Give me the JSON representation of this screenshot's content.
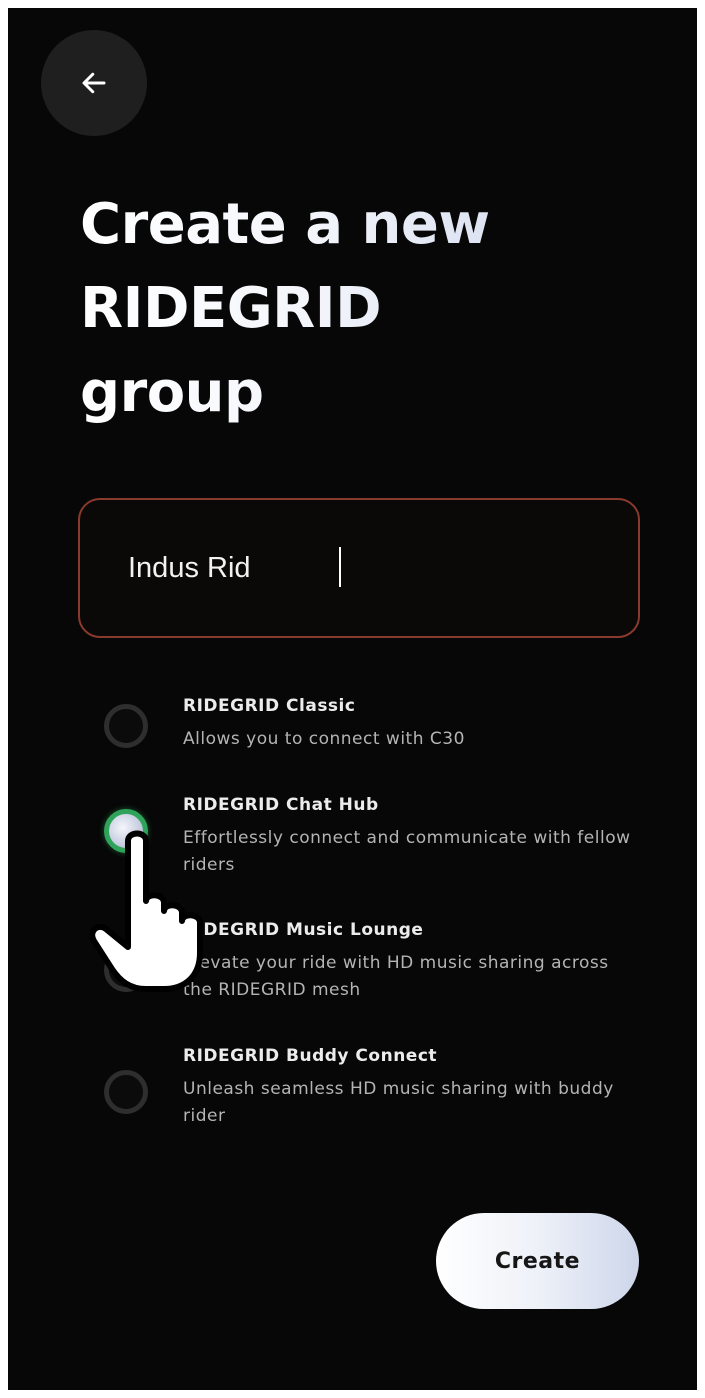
{
  "header": {
    "back_icon": "arrow-left-icon"
  },
  "title": {
    "line1": "Create a new",
    "line2": "RIDEGRID",
    "line3": "group"
  },
  "group_name": {
    "value": "Indus Rid"
  },
  "group_types": [
    {
      "title": "RIDEGRID Classic",
      "description": "Allows you to connect with C30",
      "selected": false
    },
    {
      "title": "RIDEGRID Chat Hub",
      "description": "Effortlessly connect and communicate with fellow riders",
      "selected": true
    },
    {
      "title": "RIDEGRID Music Lounge",
      "description": "Elevate your ride with HD music sharing across the RIDEGRID mesh",
      "selected": false
    },
    {
      "title": "RIDEGRID Buddy Connect",
      "description": "Unleash seamless HD music sharing with buddy rider",
      "selected": false
    }
  ],
  "actions": {
    "create_label": "Create"
  },
  "colors": {
    "background": "#070707",
    "field_border": "#8a3a2c",
    "selected_radio": "#2fa35a"
  }
}
